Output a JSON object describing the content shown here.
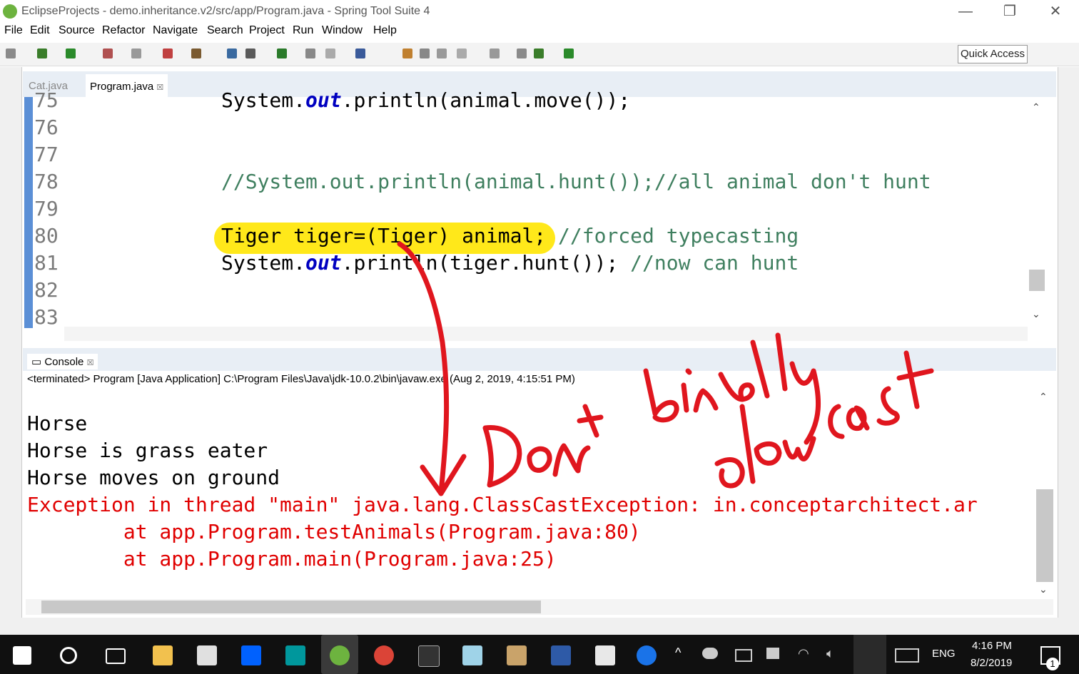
{
  "window": {
    "title": "EclipseProjects - demo.inheritance.v2/src/app/Program.java - Spring Tool Suite 4",
    "minimize": "—",
    "maximize": "❐",
    "close": "✕"
  },
  "menu": [
    "File",
    "Edit",
    "Source",
    "Refactor",
    "Navigate",
    "Search",
    "Project",
    "Run",
    "Window",
    "Help"
  ],
  "toolbar": {
    "quick_access": "Quick Access"
  },
  "editor": {
    "tabs": [
      {
        "label": "Cat.java",
        "active": false
      },
      {
        "label": "Program.java",
        "active": true,
        "close": "☒"
      }
    ],
    "lines": [
      {
        "num": "75",
        "code": "System.out.println(animal.move());"
      },
      {
        "num": "76",
        "code": ""
      },
      {
        "num": "77",
        "code": ""
      },
      {
        "num": "78",
        "code": "//System.out.println(animal.hunt());//all animal don't hunt"
      },
      {
        "num": "79",
        "code": ""
      },
      {
        "num": "80",
        "code": "Tiger tiger=(Tiger) animal; //forced typecasting"
      },
      {
        "num": "81",
        "code": "System.out.println(tiger.hunt()); //now can hunt"
      },
      {
        "num": "82",
        "code": ""
      },
      {
        "num": "83",
        "code": ""
      }
    ],
    "line75": {
      "pre": "System.",
      "kw": "out",
      "post": ".println(animal.move());"
    },
    "line80": {
      "code": "Tiger tiger=(Tiger) animal; ",
      "comment": "//forced typecasting"
    },
    "line81": {
      "pre": "System.",
      "kw": "out",
      "post": ".println(tiger.hunt()); ",
      "comment": "//now can hunt"
    },
    "line78": {
      "comment": "//System.out.println(animal.hunt());//all animal don't hunt"
    }
  },
  "console": {
    "tab_label": "Console",
    "tab_close": "☒",
    "status": "<terminated> Program [Java Application] C:\\Program Files\\Java\\jdk-10.0.2\\bin\\javaw.exe (Aug 2, 2019, 4:15:51 PM)",
    "output": [
      "Horse",
      "Horse is grass eater",
      "Horse moves on ground"
    ],
    "errors": [
      "Exception in thread \"main\" java.lang.ClassCastException: in.conceptarchitect.ar",
      "        at app.Program.testAnimals(Program.java:80)",
      "        at app.Program.main(Program.java:25)"
    ]
  },
  "annotations": {
    "ink_text_1": "Dont blindly",
    "ink_text_2": "dow cast",
    "ink_color": "#e0161e"
  },
  "taskbar": {
    "lang": "ENG",
    "time": "4:16 PM",
    "date": "8/2/2019",
    "notifications": "1"
  },
  "colors": {
    "highlight": "#ffe81a",
    "error": "#e00000",
    "comment": "#3f7f5f",
    "keyword": "#0000c0"
  }
}
